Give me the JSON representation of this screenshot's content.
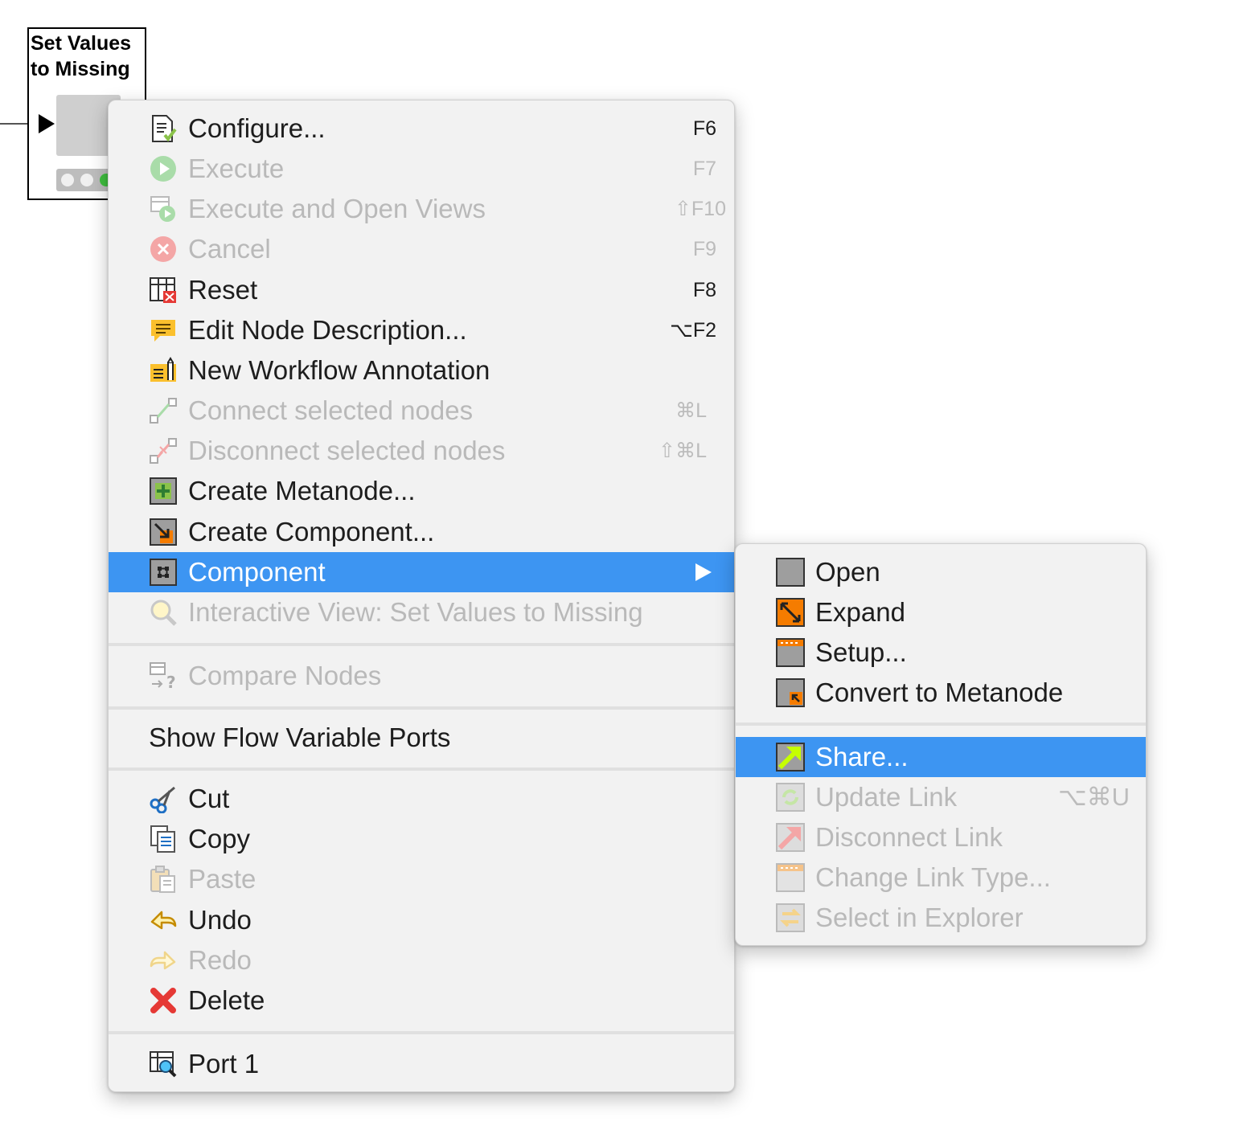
{
  "node": {
    "title_line1": "Set Values",
    "title_line2": "to Missing"
  },
  "context_menu": {
    "items": [
      {
        "label": "Configure...",
        "shortcut": "F6",
        "icon": "configure-icon",
        "enabled": true
      },
      {
        "label": "Execute",
        "shortcut": "F7",
        "icon": "execute-icon",
        "enabled": false
      },
      {
        "label": "Execute and Open Views",
        "shortcut": "⇧F10",
        "icon": "execute-open-views-icon",
        "enabled": false
      },
      {
        "label": "Cancel",
        "shortcut": "F9",
        "icon": "cancel-icon",
        "enabled": false
      },
      {
        "label": "Reset",
        "shortcut": "F8",
        "icon": "reset-icon",
        "enabled": true
      },
      {
        "label": "Edit Node Description...",
        "shortcut": "⌥F2",
        "icon": "node-description-icon",
        "enabled": true
      },
      {
        "label": "New Workflow Annotation",
        "shortcut": "",
        "icon": "annotation-icon",
        "enabled": true
      },
      {
        "label": "Connect selected nodes",
        "shortcut": "⌘L",
        "icon": "connect-icon",
        "enabled": false
      },
      {
        "label": "Disconnect selected nodes",
        "shortcut": "⇧⌘L",
        "icon": "disconnect-icon",
        "enabled": false
      },
      {
        "label": "Create Metanode...",
        "shortcut": "",
        "icon": "create-metanode-icon",
        "enabled": true
      },
      {
        "label": "Create Component...",
        "shortcut": "",
        "icon": "create-component-icon",
        "enabled": true
      },
      {
        "label": "Component",
        "shortcut": "",
        "icon": "component-icon",
        "enabled": true,
        "highlighted": true
      },
      {
        "label": "Interactive View: Set Values to Missing",
        "shortcut": "",
        "icon": "magnifier-icon",
        "enabled": false
      },
      {
        "label": "Compare Nodes",
        "shortcut": "",
        "icon": "compare-icon",
        "enabled": false
      },
      {
        "label": "Show Flow Variable Ports",
        "shortcut": "",
        "icon": "",
        "enabled": true
      },
      {
        "label": "Cut",
        "shortcut": "",
        "icon": "scissors-icon",
        "enabled": true
      },
      {
        "label": "Copy",
        "shortcut": "",
        "icon": "copy-icon",
        "enabled": true
      },
      {
        "label": "Paste",
        "shortcut": "",
        "icon": "paste-icon",
        "enabled": false
      },
      {
        "label": "Undo",
        "shortcut": "",
        "icon": "undo-icon",
        "enabled": true
      },
      {
        "label": "Redo",
        "shortcut": "",
        "icon": "redo-icon",
        "enabled": false
      },
      {
        "label": "Delete",
        "shortcut": "",
        "icon": "delete-icon",
        "enabled": true
      },
      {
        "label": "Port 1",
        "shortcut": "",
        "icon": "port-view-icon",
        "enabled": true
      }
    ]
  },
  "component_submenu": {
    "items": [
      {
        "label": "Open",
        "shortcut": "",
        "icon": "open-icon",
        "enabled": true
      },
      {
        "label": "Expand",
        "shortcut": "",
        "icon": "expand-icon",
        "enabled": true
      },
      {
        "label": "Setup...",
        "shortcut": "",
        "icon": "setup-icon",
        "enabled": true
      },
      {
        "label": "Convert to Metanode",
        "shortcut": "",
        "icon": "convert-icon",
        "enabled": true
      },
      {
        "label": "Share...",
        "shortcut": "",
        "icon": "share-icon",
        "enabled": true,
        "highlighted": true
      },
      {
        "label": "Update Link",
        "shortcut": "⌥⌘U",
        "icon": "update-link-icon",
        "enabled": false
      },
      {
        "label": "Disconnect Link",
        "shortcut": "",
        "icon": "disconnect-link-icon",
        "enabled": false
      },
      {
        "label": "Change Link Type...",
        "shortcut": "",
        "icon": "change-link-type-icon",
        "enabled": false
      },
      {
        "label": "Select in Explorer",
        "shortcut": "",
        "icon": "select-explorer-icon",
        "enabled": false
      }
    ]
  },
  "colors": {
    "highlight": "#3d95f2",
    "menu_background": "#f2f2f2",
    "disabled_text": "#b9b9b9"
  }
}
